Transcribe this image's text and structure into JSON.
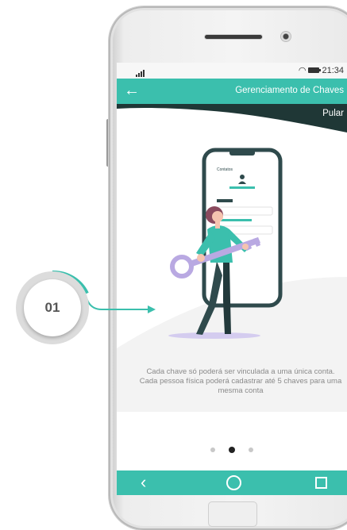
{
  "status_bar": {
    "time": "21:34",
    "icons": [
      "signal-icon",
      "wifi-icon",
      "battery-icon"
    ]
  },
  "app_bar": {
    "back_icon": "arrow-left-icon",
    "title": "Gerenciamento de Chaves"
  },
  "onboarding": {
    "skip_label": "Pular",
    "illustration": {
      "contacts_label": "Contatos"
    },
    "description": "Cada chave só poderá ser vinculada a uma única conta. Cada pessoa física poderá cadastrar até 5 chaves para uma mesma conta",
    "pages": 3,
    "active_page": 2
  },
  "nav_bar": {
    "items": [
      "back-icon",
      "home-icon",
      "recent-apps-icon"
    ]
  },
  "callout": {
    "number": "01"
  },
  "colors": {
    "accent": "#3bbfad",
    "dark": "#213a3a",
    "key": "#b9a9e2"
  }
}
